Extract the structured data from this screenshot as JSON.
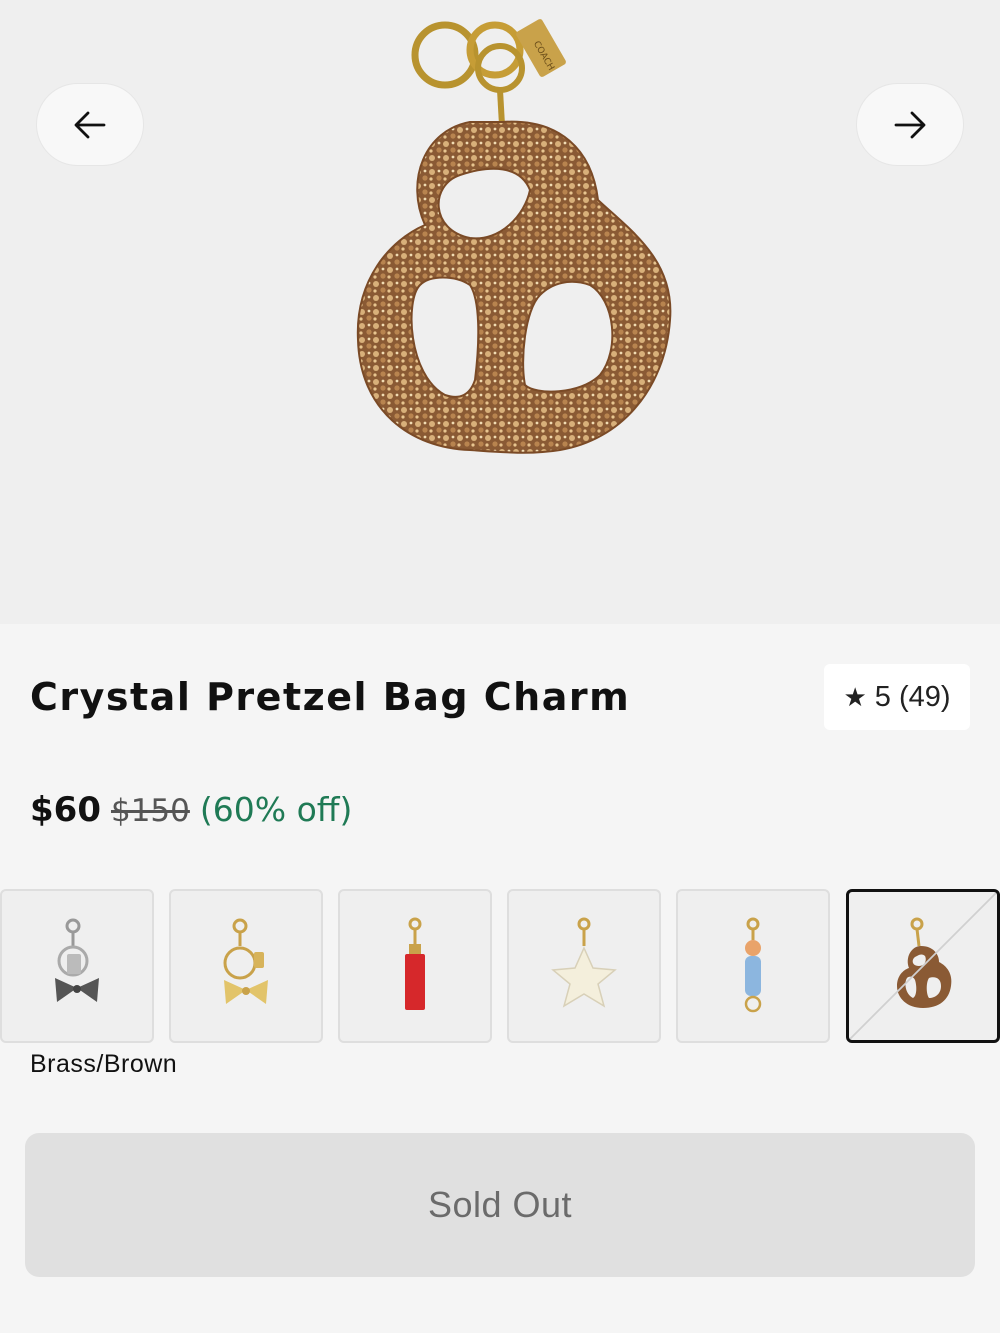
{
  "gallery": {
    "prev_icon": "arrow-left-icon",
    "next_icon": "arrow-right-icon",
    "brand_tag_text": "COACH"
  },
  "product": {
    "title": "Crystal Pretzel Bag Charm",
    "rating": {
      "icon": "star-icon",
      "score": "5",
      "count": "(49)"
    },
    "price": {
      "current": "$60",
      "original": "$150",
      "discount": "(60% off)"
    },
    "selected_color": "Brass/Brown"
  },
  "swatches": [
    {
      "name": "silver-bow-charm"
    },
    {
      "name": "gold-bow-charm"
    },
    {
      "name": "red-lipstick-charm"
    },
    {
      "name": "cream-star-charm"
    },
    {
      "name": "blue-character-charm"
    },
    {
      "name": "crystal-pretzel-charm",
      "selected": true,
      "unavailable": true
    }
  ],
  "cta": {
    "label": "Sold Out"
  },
  "colors": {
    "discount": "#1f7a55",
    "cta_bg": "#e0e0e0",
    "cta_text": "#6b6b6b"
  }
}
